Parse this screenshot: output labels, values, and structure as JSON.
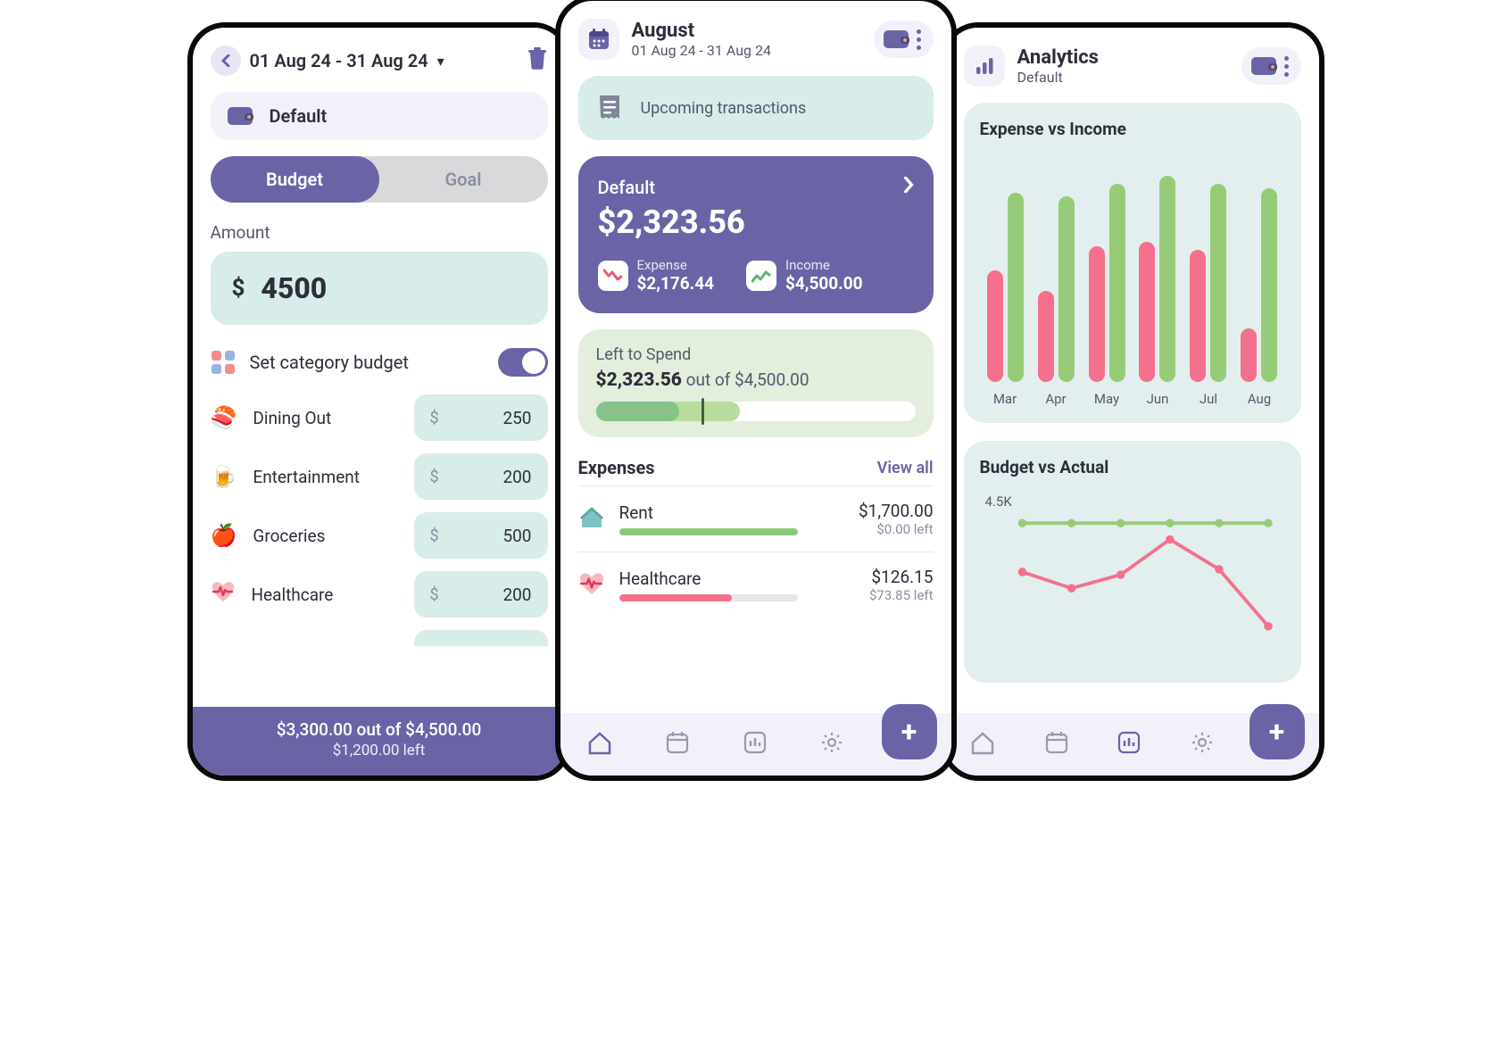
{
  "budget": {
    "date_range": "01 Aug 24 - 31 Aug 24",
    "wallet_name": "Default",
    "tabs": {
      "budget": "Budget",
      "goal": "Goal"
    },
    "amount_label": "Amount",
    "amount_value": "4500",
    "set_cat_label": "Set category budget",
    "items": [
      {
        "name": "Dining Out",
        "value": "250"
      },
      {
        "name": "Entertainment",
        "value": "200"
      },
      {
        "name": "Groceries",
        "value": "500"
      },
      {
        "name": "Healthcare",
        "value": "200"
      }
    ],
    "summary_line1": "$3,300.00 out of $4,500.00",
    "summary_line2": "$1,200.00 left"
  },
  "home": {
    "title": "August",
    "date_range": "01 Aug 24 - 31 Aug 24",
    "upcoming_label": "Upcoming transactions",
    "balance": {
      "wallet": "Default",
      "amount": "$2,323.56",
      "expense_label": "Expense",
      "expense_value": "$2,176.44",
      "income_label": "Income",
      "income_value": "$4,500.00"
    },
    "left_to_spend": {
      "title": "Left to Spend",
      "strong": "$2,323.56",
      "rest": " out of $4,500.00"
    },
    "expenses_title": "Expenses",
    "view_all": "View all",
    "expenses": [
      {
        "name": "Rent",
        "amount": "$1,700.00",
        "left": "$0.00 left",
        "pct": 100,
        "color": "#8BC97A"
      },
      {
        "name": "Healthcare",
        "amount": "$126.15",
        "left": "$73.85 left",
        "pct": 63,
        "color": "#F5708C"
      }
    ]
  },
  "analytics": {
    "title": "Analytics",
    "subtitle": "Default",
    "chart1_title": "Expense vs Income",
    "chart2_title": "Budget vs Actual",
    "budget_tick": "4.5K"
  },
  "chart_data": [
    {
      "type": "bar",
      "title": "Expense vs Income",
      "categories": [
        "Mar",
        "Apr",
        "May",
        "Jun",
        "Jul",
        "Aug"
      ],
      "series": [
        {
          "name": "Expense",
          "values": [
            135,
            110,
            165,
            170,
            160,
            65
          ]
        },
        {
          "name": "Income",
          "values": [
            230,
            225,
            240,
            250,
            240,
            235
          ]
        }
      ],
      "ylim": [
        0,
        260
      ]
    },
    {
      "type": "line",
      "title": "Budget vs Actual",
      "categories": [
        "Mar",
        "Apr",
        "May",
        "Jun",
        "Jul",
        "Aug"
      ],
      "series": [
        {
          "name": "Budget",
          "values": [
            4500,
            4500,
            4500,
            4500,
            4500,
            4500
          ]
        },
        {
          "name": "Actual",
          "values": [
            2700,
            2100,
            2600,
            3900,
            2800,
            700
          ]
        }
      ],
      "ylim": [
        0,
        5000
      ],
      "yticks": [
        "4.5K"
      ]
    }
  ]
}
